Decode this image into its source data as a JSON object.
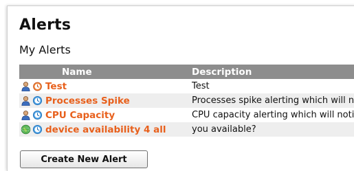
{
  "page": {
    "title": "Alerts",
    "subtitle": "My Alerts"
  },
  "table": {
    "columns": [
      "Name",
      "Description"
    ],
    "rows": [
      {
        "user_icon": "user-icon",
        "type_icon": "alarm-clock-icon",
        "name": "Test",
        "description": "Test"
      },
      {
        "user_icon": "user-icon",
        "type_icon": "clock-icon",
        "name": "Processes Spike",
        "description": "Processes spike alerting which will not"
      },
      {
        "user_icon": "user-icon",
        "type_icon": "clock-icon",
        "name": "CPU Capacity",
        "description": "CPU capacity alerting which will notify"
      },
      {
        "user_icon": "globe-icon",
        "type_icon": "clock-icon",
        "name": "device availability 4 all",
        "description": "you available?"
      }
    ]
  },
  "actions": {
    "create_label": "Create New Alert"
  },
  "colors": {
    "alert_name": "#e8601c",
    "header_bg": "#8d8d8d",
    "alt_row_bg": "#eeeeee"
  }
}
